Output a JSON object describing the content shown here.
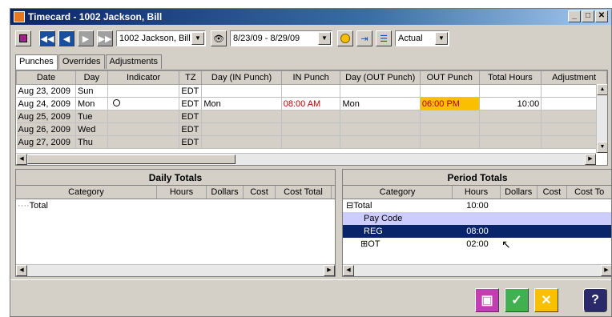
{
  "window": {
    "title": "Timecard - 1002 Jackson, Bill"
  },
  "toolbar": {
    "employee": "1002 Jackson, Bill",
    "period": "8/23/09 - 8/29/09",
    "view": "Actual"
  },
  "tabs": [
    "Punches",
    "Overrides",
    "Adjustments"
  ],
  "grid": {
    "columns": [
      "Date",
      "Day",
      "Indicator",
      "TZ",
      "Day (IN Punch)",
      "IN Punch",
      "Day (OUT Punch)",
      "OUT Punch",
      "Total Hours",
      "Adjustment"
    ],
    "rows": [
      {
        "date": "Aug 23, 2009",
        "day": "Sun",
        "tz": "EDT",
        "day_in": "",
        "in": "",
        "day_out": "",
        "out": "",
        "total": ""
      },
      {
        "date": "Aug 24, 2009",
        "day": "Mon",
        "tz": "EDT",
        "day_in": "Mon",
        "in": "08:00 AM",
        "day_out": "Mon",
        "out": "06:00 PM",
        "total": "10:00"
      },
      {
        "date": "Aug 25, 2009",
        "day": "Tue",
        "tz": "EDT",
        "day_in": "",
        "in": "",
        "day_out": "",
        "out": "",
        "total": ""
      },
      {
        "date": "Aug 26, 2009",
        "day": "Wed",
        "tz": "EDT",
        "day_in": "",
        "in": "",
        "day_out": "",
        "out": "",
        "total": ""
      },
      {
        "date": "Aug 27, 2009",
        "day": "Thu",
        "tz": "EDT",
        "day_in": "",
        "in": "",
        "day_out": "",
        "out": "",
        "total": ""
      }
    ]
  },
  "daily": {
    "title": "Daily Totals",
    "columns": [
      "Category",
      "Hours",
      "Dollars",
      "Cost",
      "Cost Total"
    ],
    "rows": [
      {
        "label": "Total"
      }
    ]
  },
  "period": {
    "title": "Period Totals",
    "columns": [
      "Category",
      "Hours",
      "Dollars",
      "Cost",
      "Cost To"
    ],
    "rows": [
      {
        "label": "Total",
        "hours": "10:00"
      },
      {
        "label": "Pay Code",
        "hours": ""
      },
      {
        "label": "REG",
        "hours": "08:00"
      },
      {
        "label": "OT",
        "hours": "02:00"
      }
    ]
  },
  "colors": {
    "highlight": "#f8c000",
    "selected": "#0a246a",
    "paycode_row": "#ccccff"
  }
}
